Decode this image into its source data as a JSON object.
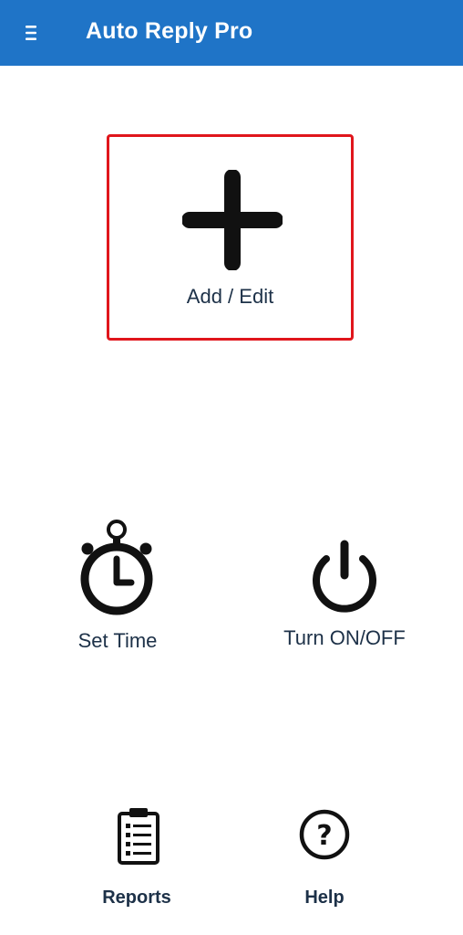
{
  "appbar": {
    "title": "Auto Reply Pro",
    "menu_icon": "menu-icon",
    "color": "#1f74c7"
  },
  "main": {
    "add_edit": {
      "label": "Add / Edit",
      "icon": "plus-icon",
      "highlight_color": "#e0161c"
    },
    "set_time": {
      "label": "Set Time",
      "icon": "stopwatch-icon"
    },
    "turn_onoff": {
      "label": "Turn ON/OFF",
      "icon": "power-icon"
    }
  },
  "bottom": {
    "reports": {
      "label": "Reports",
      "icon": "clipboard-icon"
    },
    "help": {
      "label": "Help",
      "icon": "help-icon"
    }
  }
}
